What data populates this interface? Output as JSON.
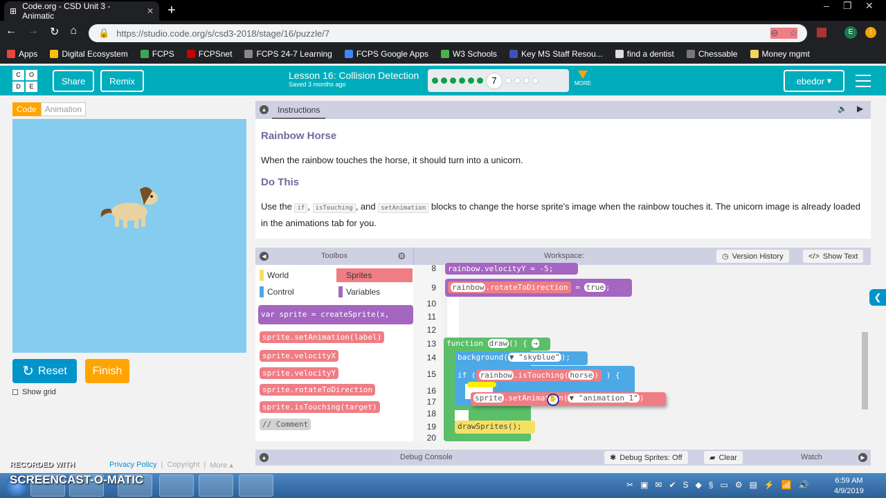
{
  "browser": {
    "tab_title": "Code.org - CSD Unit 3 - Animatic",
    "url_host": "https://studio.code.org",
    "url_path": "/s/csd3-2018/stage/16/puzzle/7",
    "profile_initial": "E",
    "bookmarks": [
      {
        "label": "Apps",
        "color": "#e8453c"
      },
      {
        "label": "Digital Ecosystem",
        "color": "#f4c20d"
      },
      {
        "label": "FCPS",
        "color": "#3aa757"
      },
      {
        "label": "FCPSnet",
        "color": "#c00"
      },
      {
        "label": "FCPS 24-7 Learning",
        "color": "#888"
      },
      {
        "label": "FCPS Google Apps",
        "color": "#4285f4"
      },
      {
        "label": "W3 Schools",
        "color": "#4caf50"
      },
      {
        "label": "Key MS Staff Resou...",
        "color": "#3f51b5"
      },
      {
        "label": "find a dentist",
        "color": "#ddd"
      },
      {
        "label": "Chessable",
        "color": "#777"
      },
      {
        "label": "Money mgmt",
        "color": "#f4d35e"
      }
    ]
  },
  "header": {
    "logo": [
      "C",
      "O",
      "D",
      "E"
    ],
    "share": "Share",
    "remix": "Remix",
    "lesson_title": "Lesson 16: Collision Detection",
    "saved": "Saved 3 months ago",
    "current_puzzle": "7",
    "completed": 6,
    "remaining": 4,
    "more": "MORE",
    "user": "ebedor"
  },
  "left": {
    "code_tab": "Code",
    "animation_tab": "Animation",
    "reset": "Reset",
    "finish": "Finish",
    "show_grid": "Show grid",
    "stage_color": "#86ccee"
  },
  "instructions": {
    "tab": "Instructions",
    "title": "Rainbow Horse",
    "text1": "When the rainbow touches the horse, it should turn into a unicorn.",
    "subtitle": "Do This",
    "use": "Use the",
    "code1": "if",
    "code2": "isTouching",
    "and": ", and",
    "code3": "setAnimation",
    "rest": "blocks to change the horse sprite's image when the rainbow touches it. The unicorn image is already loaded in the animations tab for you."
  },
  "toolbox": {
    "title": "Toolbox",
    "categories": [
      {
        "label": "World",
        "color": "#f5e064"
      },
      {
        "label": "Sprites",
        "color": "#f07d84"
      },
      {
        "label": "Control",
        "color": "#4da9e6"
      },
      {
        "label": "Variables",
        "color": "#a566c1"
      }
    ],
    "blocks": [
      "sprite.setAnimation(label)",
      "sprite.velocityX",
      "sprite.velocityY",
      "sprite.rotateToDirection",
      "sprite.isTouching(target)",
      "// Comment"
    ],
    "var_block": "var sprite = createSprite(x,"
  },
  "workspace": {
    "title": "Workspace:",
    "version_history": "Version History",
    "show_text": "Show Text",
    "line_numbers": [
      "8",
      "9",
      "10",
      "11",
      "12",
      "13",
      "14",
      "15",
      "16",
      "17",
      "18",
      "19",
      "20"
    ],
    "code": {
      "l8": "rainbow.velocityY = -5;",
      "l9_obj": "rainbow",
      "l9_prop": ".rotateToDirection",
      "l9_val": "true",
      "fn": "function",
      "fn_name": "draw",
      "fn_rest": "() {",
      "bg": "background(",
      "bg_val": "▼ \"skyblue\"",
      "bg_end": ");",
      "if": "if (",
      "if_obj": "rainbow",
      "if_m": ".isTouching(",
      "if_arg": "horse",
      "if_end": ") {",
      "close": "}",
      "drag_obj": "sprite",
      "drag_m": ".setAnimation(",
      "drag_arg": "▼ \"animation_1\"",
      "drag_end": ")",
      "draw_sprites": "drawSprites();"
    }
  },
  "debug": {
    "title": "Debug Console",
    "debug_sprites": "Debug Sprites: Off",
    "clear": "Clear",
    "watch": "Watch"
  },
  "footer": {
    "privacy": "Privacy Policy",
    "copyright": "Copyright",
    "more": "More ▴"
  },
  "watermark": {
    "recorded": "RECORDED WITH",
    "brand": "SCREENCAST-O-MATIC"
  },
  "taskbar": {
    "time": "6:59 AM",
    "date": "4/9/2019"
  }
}
